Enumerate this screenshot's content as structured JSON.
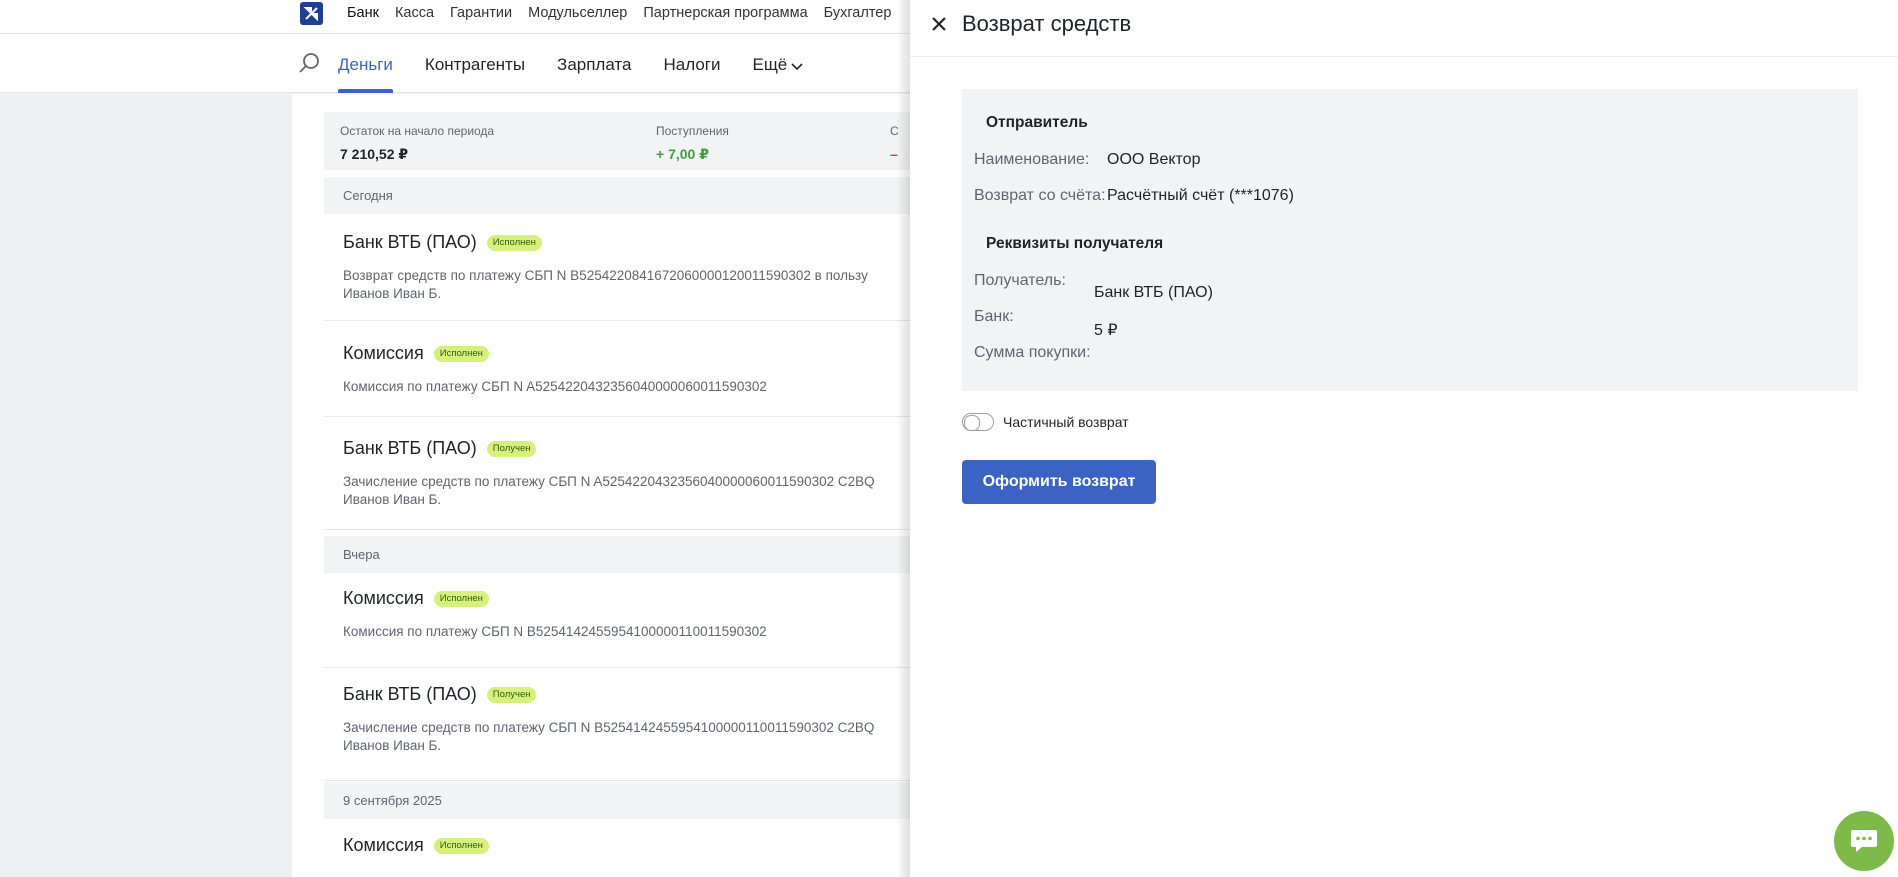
{
  "topnav": {
    "items": [
      "Банк",
      "Касса",
      "Гарантии",
      "Модульселлер",
      "Партнерская программа",
      "Бухгалтер"
    ]
  },
  "mainnav": {
    "tabs": [
      {
        "label": "Деньги",
        "active": true
      },
      {
        "label": "Контрагенты",
        "active": false
      },
      {
        "label": "Зарплата",
        "active": false
      },
      {
        "label": "Налоги",
        "active": false
      },
      {
        "label": "Ещё",
        "active": false
      }
    ]
  },
  "summary": {
    "opening_label": "Остаток на начало периода",
    "opening_value": "7 210,52 ₽",
    "income_label": "Поступления",
    "income_value": "+ 7,00 ₽",
    "outgo_label_partial": "С",
    "outgo_value_partial": "–"
  },
  "feed": {
    "today": "Сегодня",
    "yesterday": "Вчера",
    "sep9": "9 сентября 2025",
    "ops": [
      {
        "title": "Банк ВТБ (ПАО)",
        "status": "Исполнен",
        "desc1": "Возврат средств по платежу СБП N B5254220841672060000120011590302 в пользу",
        "desc2": "Иванов Иван Б."
      },
      {
        "title": "Комиссия",
        "status": "Исполнен",
        "desc1": "Комиссия по платежу СБП N A5254220432356040000060011590302",
        "desc2": ""
      },
      {
        "title": "Банк ВТБ (ПАО)",
        "status": "Получен",
        "desc1": "Зачисление средств по платежу СБП N A5254220432356040000060011590302 C2BQ",
        "desc2": "Иванов Иван Б."
      },
      {
        "title": "Комиссия",
        "status": "Исполнен",
        "desc1": "Комиссия по платежу СБП N B5254142455954100000110011590302",
        "desc2": ""
      },
      {
        "title": "Банк ВТБ (ПАО)",
        "status": "Получен",
        "desc1": "Зачисление средств по платежу СБП N B5254142455954100000110011590302 C2BQ",
        "desc2": "Иванов Иван Б."
      },
      {
        "title": "Комиссия",
        "status": "Исполнен",
        "desc1": "",
        "desc2": ""
      }
    ]
  },
  "panel": {
    "title": "Возврат средств",
    "sender_heading": "Отправитель",
    "name_label": "Наименование:",
    "name_value": "ООО Вектор",
    "account_label": "Возврат со счёта:",
    "account_value": "Расчётный счёт (***1076)",
    "recipient_heading": "Реквизиты получателя",
    "recipient_label": "Получатель:",
    "bank_label": "Банк:",
    "amount_label": "Сумма покупки:",
    "bank_value": "Банк ВТБ (ПАО)",
    "amount_value": "5 ₽",
    "partial_label": "Частичный возврат",
    "partial_enabled": false,
    "submit_label": "Оформить возврат"
  },
  "colors": {
    "accent": "#3b63c4",
    "badge_bg": "#d7ef7b",
    "chat": "#7dba48",
    "income": "#3da13a"
  }
}
